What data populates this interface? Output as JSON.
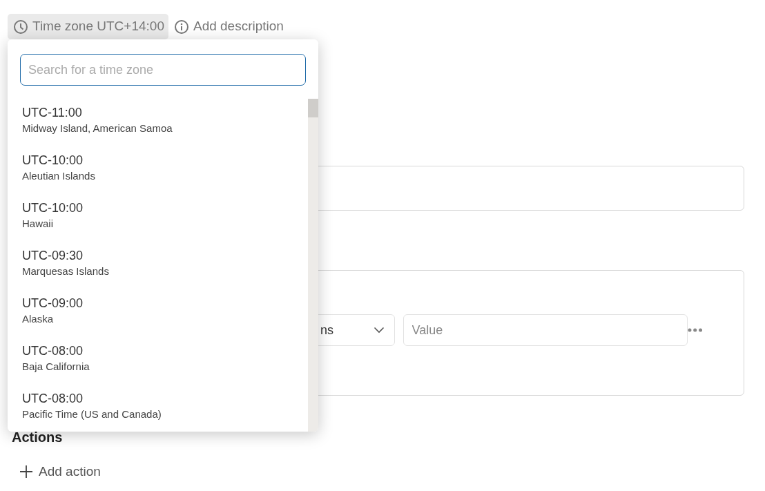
{
  "header": {
    "time_zone_button": "Time zone UTC+14:00",
    "description_button": "Add description"
  },
  "condition": {
    "operator_value": "ns",
    "value_placeholder": "Value"
  },
  "actions": {
    "heading": "Actions",
    "add_button": "Add action"
  },
  "time_zone_dropdown": {
    "search": {
      "placeholder": "Search for a time zone"
    },
    "options": [
      {
        "offset": "UTC-11:00",
        "region": "Midway Island, American Samoa"
      },
      {
        "offset": "UTC-10:00",
        "region": "Aleutian Islands"
      },
      {
        "offset": "UTC-10:00",
        "region": "Hawaii"
      },
      {
        "offset": "UTC-09:30",
        "region": "Marquesas Islands"
      },
      {
        "offset": "UTC-09:00",
        "region": "Alaska"
      },
      {
        "offset": "UTC-08:00",
        "region": "Baja California"
      },
      {
        "offset": "UTC-08:00",
        "region": "Pacific Time (US and Canada)"
      }
    ]
  }
}
